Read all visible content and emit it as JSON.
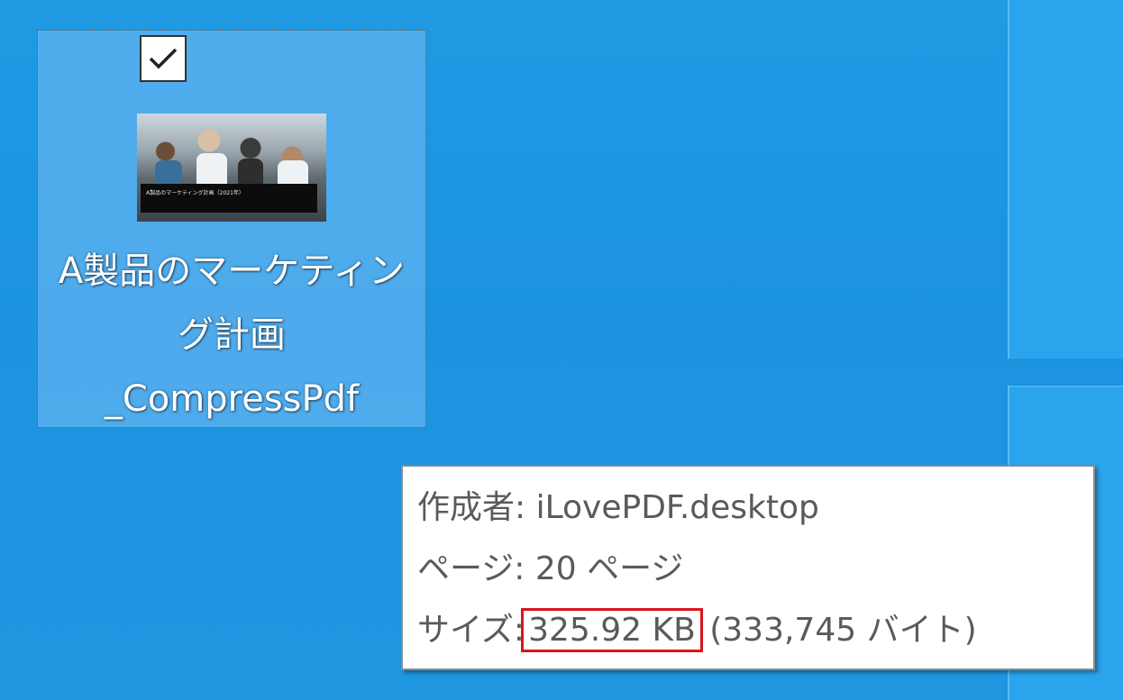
{
  "desktop": {
    "background_color": "#1f98e1",
    "file_icon": {
      "icon_type": "pdf-thumbnail",
      "selected": true,
      "checkbox_checked": true,
      "name_lines": [
        "A製品のマーケティン",
        "グ計画",
        "_CompressPdf"
      ],
      "thumbnail_caption": "A製品のマーケティング計画（2021年）"
    }
  },
  "tooltip": {
    "author_label": "作成者:",
    "author_value": "iLovePDF.desktop",
    "pages_label": "ページ:",
    "pages_value": "20 ページ",
    "size_label": "サイズ:",
    "size_value": "325.92 KB",
    "size_bytes": "(333,745 バイト)",
    "highlight_color": "#d9151f"
  }
}
